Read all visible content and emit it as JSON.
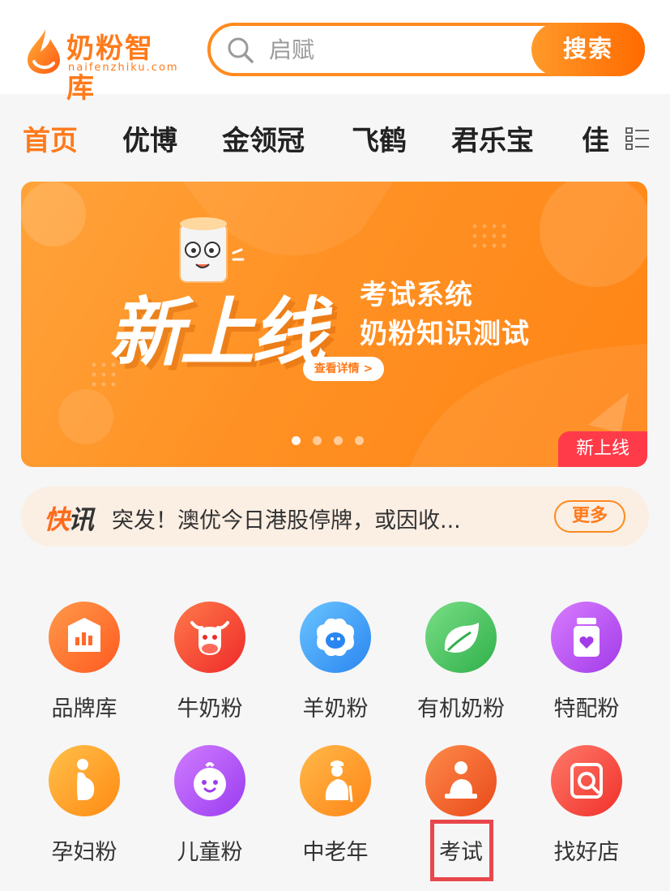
{
  "header": {
    "logo_title": "奶粉智库",
    "logo_sub": "naifenzhiku.com",
    "search_placeholder": "启赋",
    "search_button": "搜索"
  },
  "tabs": [
    {
      "label": "首页",
      "active": true
    },
    {
      "label": "优博",
      "active": false
    },
    {
      "label": "金领冠",
      "active": false
    },
    {
      "label": "飞鹤",
      "active": false
    },
    {
      "label": "君乐宝",
      "active": false
    },
    {
      "label": "佳",
      "active": false
    }
  ],
  "tab_menu_icon": "list-menu-icon",
  "banner": {
    "big_text": "新上线",
    "line1": "考试系统",
    "line2": "奶粉知识测试",
    "button": "查看详情 >",
    "tag": "新上线",
    "dots": 4,
    "active_dot": 0
  },
  "ticker": {
    "logo_a": "快",
    "logo_b": "讯",
    "text": "突发！澳优今日港股停牌，或因收...",
    "more": "更多"
  },
  "grid": [
    {
      "label": "品牌库",
      "icon": "chart-box-icon",
      "color_from": "#ff8a3d",
      "color_to": "#ff5a1f"
    },
    {
      "label": "牛奶粉",
      "icon": "cow-icon",
      "color_from": "#ff6a4a",
      "color_to": "#ee2a2a"
    },
    {
      "label": "羊奶粉",
      "icon": "sheep-icon",
      "color_from": "#5ab8ff",
      "color_to": "#2a86f0"
    },
    {
      "label": "有机奶粉",
      "icon": "leaf-icon",
      "color_from": "#6fd67a",
      "color_to": "#2fb04a"
    },
    {
      "label": "特配粉",
      "icon": "heart-can-icon",
      "color_from": "#d36cff",
      "color_to": "#a23be8"
    },
    {
      "label": "孕妇粉",
      "icon": "pregnant-icon",
      "color_from": "#ffb23a",
      "color_to": "#ff8a12"
    },
    {
      "label": "儿童粉",
      "icon": "child-face-icon",
      "color_from": "#c86cff",
      "color_to": "#9a3cf0"
    },
    {
      "label": "中老年",
      "icon": "elder-icon",
      "color_from": "#ffae3a",
      "color_to": "#ff8616"
    },
    {
      "label": "考试",
      "icon": "exam-person-icon",
      "color_from": "#ff7a3a",
      "color_to": "#f04a1a"
    },
    {
      "label": "找好店",
      "icon": "shop-search-icon",
      "color_from": "#ff6a5a",
      "color_to": "#f0302a"
    }
  ]
}
